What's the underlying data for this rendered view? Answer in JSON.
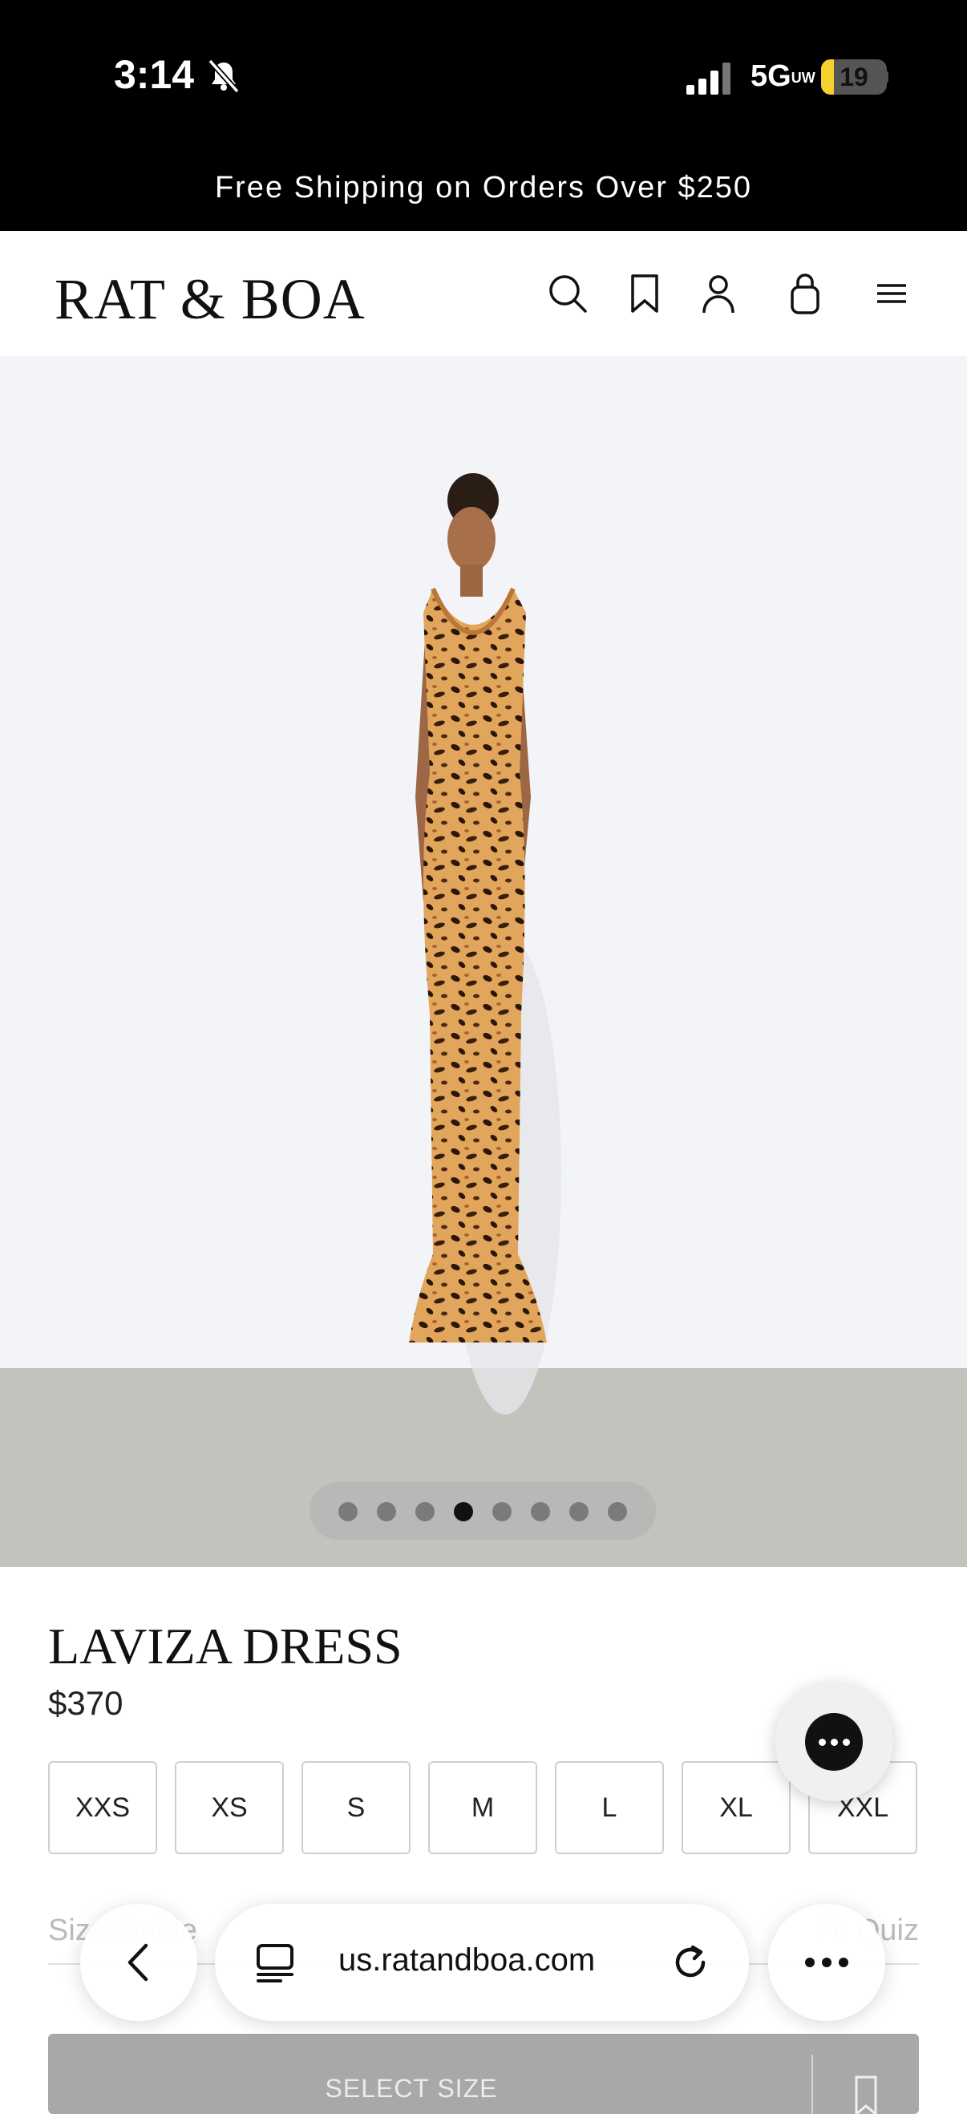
{
  "status_bar": {
    "time": "3:14",
    "network": "5G",
    "network_sub": "UW",
    "battery": "19",
    "battery_level": 0.19
  },
  "promo": {
    "text": "Free Shipping on Orders Over $250"
  },
  "header": {
    "logo": "RAT & BOA",
    "icons": [
      "search-icon",
      "bookmark-icon",
      "account-icon",
      "bag-icon",
      "menu-icon"
    ]
  },
  "gallery": {
    "image_count": 8,
    "active_index": 3
  },
  "product": {
    "title": "LAVIZA DRESS",
    "price": "$370",
    "sizes": [
      "XXS",
      "XS",
      "S",
      "M",
      "L",
      "XL",
      "XXL"
    ],
    "size_guide": "Size Guide",
    "fit_quiz": "Fit Quiz",
    "cta": "SELECT SIZE"
  },
  "browser": {
    "url": "us.ratandboa.com"
  },
  "colors": {
    "promo_bg": "#000000",
    "cta_bg": "#a8a8a8",
    "hero_bg": "#f2f4f8",
    "floor": "#c4c2bc"
  }
}
